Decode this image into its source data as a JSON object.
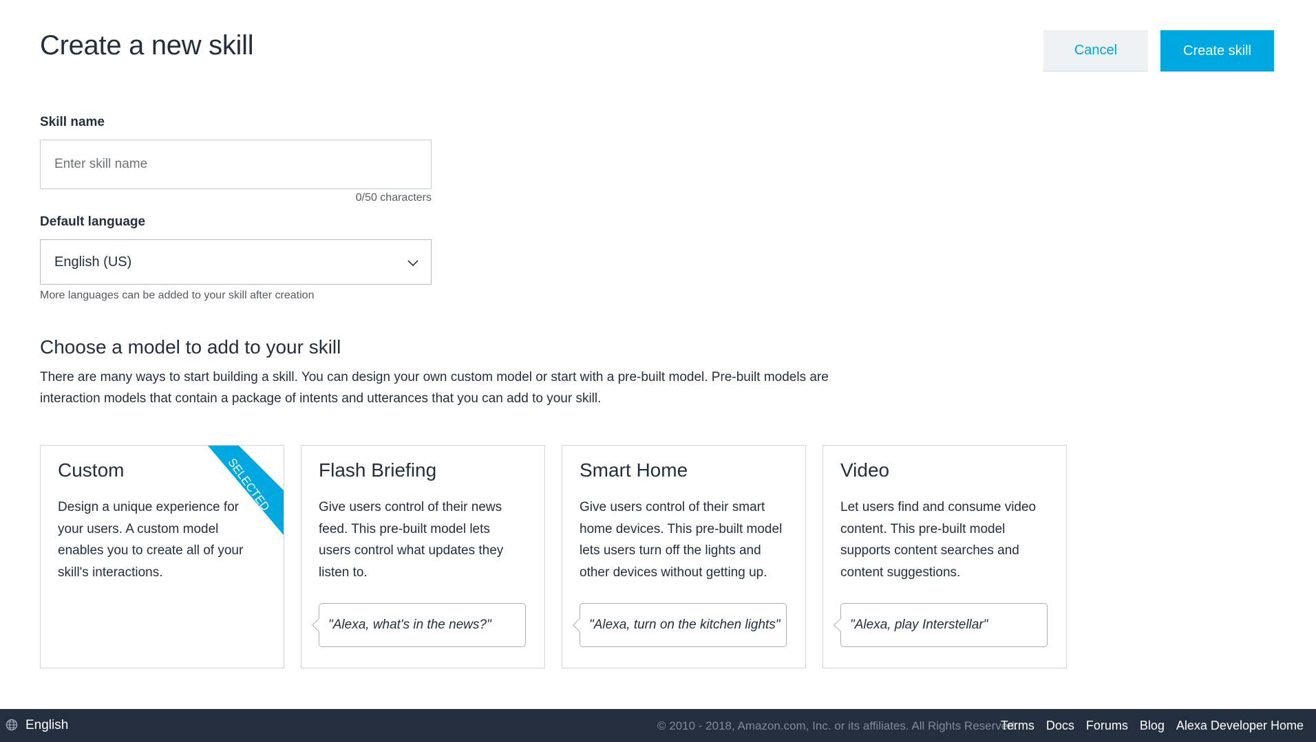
{
  "header": {
    "title": "Create a new skill",
    "cancel_label": "Cancel",
    "create_label": "Create skill"
  },
  "form": {
    "skill_name_label": "Skill name",
    "skill_name_placeholder": "Enter skill name",
    "skill_name_value": "",
    "char_count": "0/50  characters",
    "language_label": "Default language",
    "language_value": "English (US)",
    "language_hint": "More languages can be added to your skill after creation"
  },
  "models": {
    "title": "Choose a model to add to your skill",
    "description": "There are many ways to start building a skill. You can design your own custom model or start with a pre-built model.  Pre-built models are interaction models that contain a package of intents and utterances that you can add to your skill.",
    "selected_badge": "SELECTED",
    "cards": [
      {
        "title": "Custom",
        "description": "Design a unique experience for your users. A custom model enables you to create all of your skill's interactions.",
        "example": ""
      },
      {
        "title": "Flash Briefing",
        "description": "Give users control of their news feed. This pre-built model lets users control what updates they listen to.",
        "example": "\"Alexa, what's in the news?\""
      },
      {
        "title": "Smart Home",
        "description": "Give users control of their smart home devices. This pre-built model lets users turn off the lights and other devices without getting up.",
        "example": "\"Alexa, turn on the kitchen lights\""
      },
      {
        "title": "Video",
        "description": "Let users find and consume video content. This pre-built model supports content searches and content suggestions.",
        "example": "\"Alexa, play Interstellar\""
      }
    ]
  },
  "footer": {
    "language": "English",
    "copyright": "© 2010 - 2018, Amazon.com, Inc. or its affiliates. All Rights Reserved.",
    "links": [
      "Terms",
      "Docs",
      "Forums",
      "Blog",
      "Alexa Developer Home"
    ]
  },
  "icons": {
    "globe": "globe-icon",
    "chevron": "chevron-down-icon"
  },
  "colors": {
    "accent": "#00a8e1",
    "text": "#232f3e",
    "footer_bg": "#232f3e"
  }
}
